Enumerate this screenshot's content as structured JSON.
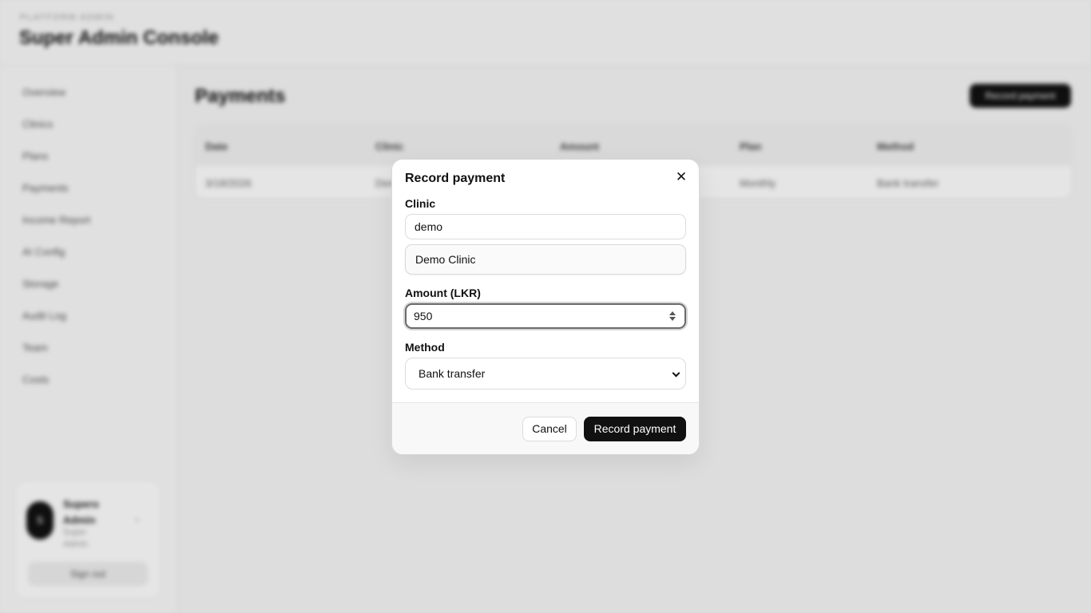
{
  "app": {
    "eyebrow": "PLATFORM ADMIN",
    "title": "Super Admin Console"
  },
  "sidebar": {
    "items": [
      {
        "label": "Overview"
      },
      {
        "label": "Clinics"
      },
      {
        "label": "Plans"
      },
      {
        "label": "Payments"
      },
      {
        "label": "Income Report"
      },
      {
        "label": "AI Config"
      },
      {
        "label": "Storage"
      },
      {
        "label": "Audit Log"
      },
      {
        "label": "Team"
      },
      {
        "label": "Costs"
      }
    ],
    "user": {
      "initial": "S",
      "name": "Supero Admin",
      "role": "Super Admin",
      "signout_label": "Sign out"
    }
  },
  "main": {
    "page_title": "Payments",
    "primary_button_label": "Record payment",
    "table": {
      "columns": [
        "Date",
        "Clinic",
        "Amount",
        "Plan",
        "Method"
      ],
      "rows": [
        {
          "date": "3/18/2026",
          "clinic": "Demo Clinic",
          "amount": "",
          "plan": "Monthly",
          "method": "Bank transfer"
        }
      ]
    }
  },
  "modal": {
    "title": "Record payment",
    "close_icon": "close-icon",
    "clinic_label": "Clinic",
    "clinic_search_value": "demo",
    "clinic_result": "Demo Clinic",
    "amount_label": "Amount (LKR)",
    "amount_value": "950",
    "method_label": "Method",
    "method_value": "Bank transfer",
    "cancel_label": "Cancel",
    "submit_label": "Record payment"
  },
  "colors": {
    "primary": "#111111",
    "backdrop": "#f6f6f6"
  }
}
